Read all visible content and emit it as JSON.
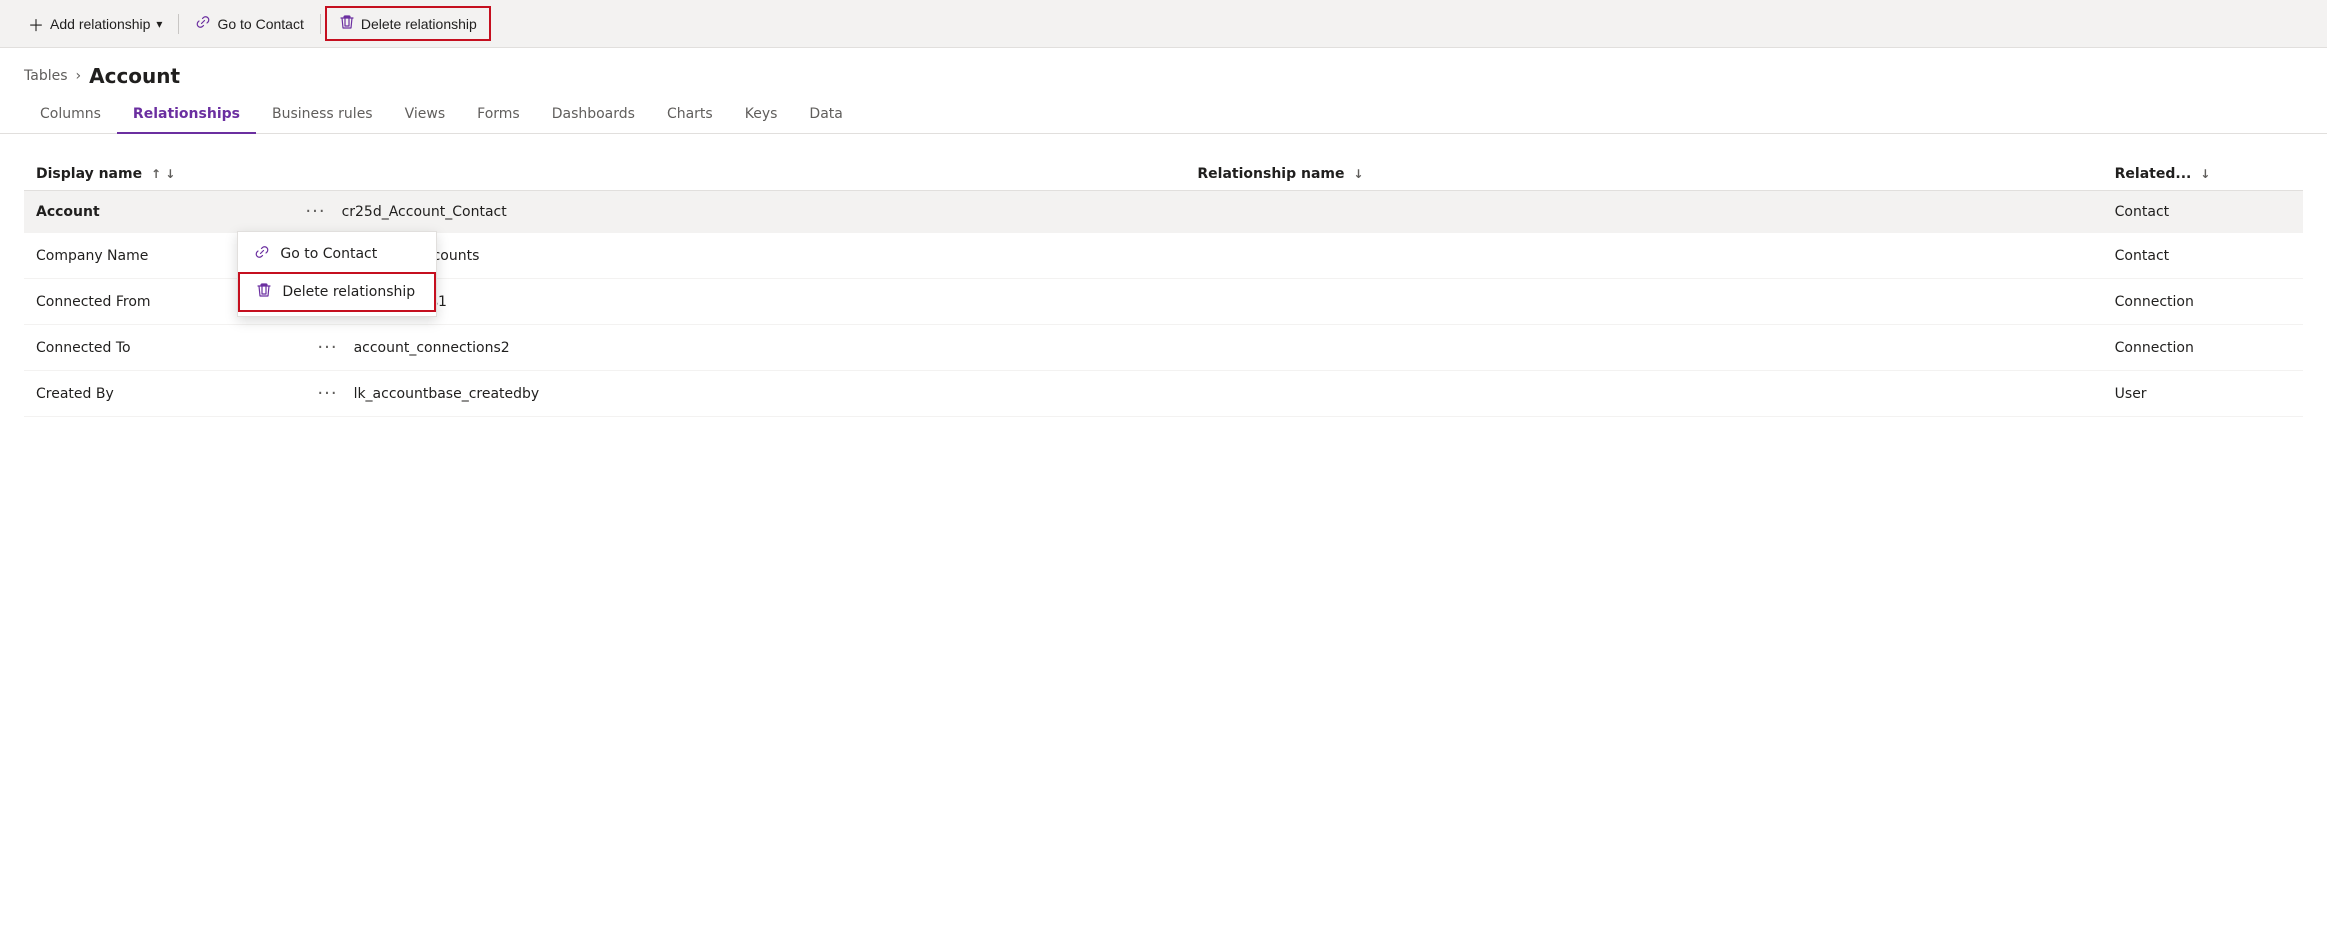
{
  "toolbar": {
    "add_relationship_label": "Add relationship",
    "add_dropdown_icon": "▾",
    "go_to_contact_label": "Go to Contact",
    "delete_relationship_label": "Delete relationship"
  },
  "breadcrumb": {
    "parent_label": "Tables",
    "separator": "›",
    "current_label": "Account"
  },
  "tabs": [
    {
      "id": "columns",
      "label": "Columns",
      "active": false
    },
    {
      "id": "relationships",
      "label": "Relationships",
      "active": true
    },
    {
      "id": "business-rules",
      "label": "Business rules",
      "active": false
    },
    {
      "id": "views",
      "label": "Views",
      "active": false
    },
    {
      "id": "forms",
      "label": "Forms",
      "active": false
    },
    {
      "id": "dashboards",
      "label": "Dashboards",
      "active": false
    },
    {
      "id": "charts",
      "label": "Charts",
      "active": false
    },
    {
      "id": "keys",
      "label": "Keys",
      "active": false
    },
    {
      "id": "data",
      "label": "Data",
      "active": false
    }
  ],
  "table": {
    "columns": [
      {
        "id": "display-name",
        "label": "Display name",
        "sort": "↑ ↓"
      },
      {
        "id": "relationship-name",
        "label": "Relationship name",
        "sort": "↓"
      },
      {
        "id": "related",
        "label": "Related...",
        "sort": "↓"
      }
    ],
    "rows": [
      {
        "id": "row-account",
        "display_name": "Account",
        "relationship_name": "cr25d_Account_Contact",
        "related": "Contact",
        "selected": true,
        "show_context_menu": true
      },
      {
        "id": "row-company-name",
        "display_name": "Company Name",
        "relationship_name": "account_accounts",
        "related": "Contact",
        "selected": false,
        "show_context_menu": false
      },
      {
        "id": "row-connected-from",
        "display_name": "Connected From",
        "relationship_name": "connections1",
        "related": "Connection",
        "selected": false,
        "show_context_menu": false
      },
      {
        "id": "row-connected-to",
        "display_name": "Connected To",
        "relationship_name": "account_connections2",
        "related": "Connection",
        "selected": false,
        "show_context_menu": false
      },
      {
        "id": "row-created-by",
        "display_name": "Created By",
        "relationship_name": "lk_accountbase_createdby",
        "related": "User",
        "selected": false,
        "show_context_menu": false
      }
    ]
  },
  "context_menu": {
    "go_to_contact": "Go to Contact",
    "delete_relationship": "Delete relationship"
  },
  "colors": {
    "accent_purple": "#6b2fa0",
    "danger_red": "#c50f1f"
  }
}
